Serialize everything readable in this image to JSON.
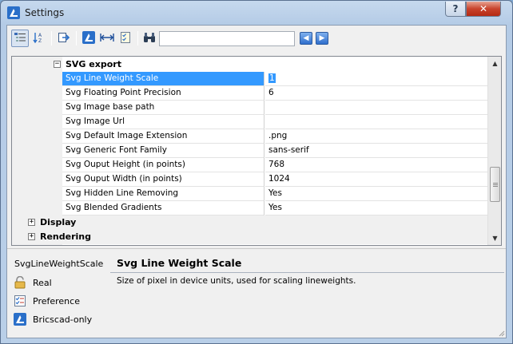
{
  "window": {
    "title": "Settings",
    "help_label": "?",
    "close_label": "✕"
  },
  "toolbar": {
    "buttons": [
      {
        "name": "categorized-view",
        "icon": "categorized-list-icon",
        "active": true
      },
      {
        "name": "alphabetical-view",
        "icon": "sort-az-icon",
        "active": false
      },
      {
        "name": "export",
        "icon": "export-icon",
        "active": false
      },
      {
        "name": "bricscad-filter",
        "icon": "bricscad-logo-icon",
        "active": false
      },
      {
        "name": "dimension-filter",
        "icon": "dimension-arrows-icon",
        "active": false
      },
      {
        "name": "checklist-filter",
        "icon": "checklist-icon",
        "active": false
      },
      {
        "name": "find",
        "icon": "binoculars-icon",
        "active": false
      }
    ],
    "search": {
      "value": "",
      "placeholder": ""
    },
    "prev_label": "◀",
    "next_label": "▶"
  },
  "grid": {
    "category": {
      "label": "SVG export",
      "expander": "−"
    },
    "properties": [
      {
        "name": "Svg Line Weight Scale",
        "value": "1",
        "selected": true
      },
      {
        "name": "Svg Floating Point Precision",
        "value": "6",
        "selected": false
      },
      {
        "name": "Svg Image base path",
        "value": "",
        "selected": false
      },
      {
        "name": "Svg Image Url",
        "value": "",
        "selected": false
      },
      {
        "name": "Svg Default Image Extension",
        "value": ".png",
        "selected": false
      },
      {
        "name": "Svg Generic Font Family",
        "value": "sans-serif",
        "selected": false
      },
      {
        "name": "Svg Ouput Height (in points)",
        "value": "768",
        "selected": false
      },
      {
        "name": "Svg Ouput Width (in points)",
        "value": "1024",
        "selected": false
      },
      {
        "name": "Svg Hidden Line Removing",
        "value": "Yes",
        "selected": false
      },
      {
        "name": "Svg Blended Gradients",
        "value": "Yes",
        "selected": false
      }
    ],
    "other_categories": [
      {
        "label": "Display",
        "expander": "+"
      },
      {
        "label": "Rendering",
        "expander": "+"
      }
    ]
  },
  "info": {
    "variable_name": "SvgLineWeightScale",
    "title": "Svg Line Weight Scale",
    "description": "Size of pixel in device units, used for scaling lineweights.",
    "attributes": [
      {
        "label": "Real",
        "icon": "lock-icon"
      },
      {
        "label": "Preference",
        "icon": "preference-checklist-icon"
      },
      {
        "label": "Bricscad-only",
        "icon": "bricscad-logo-icon"
      }
    ]
  },
  "colors": {
    "selection": "#3399ff",
    "title_bar": "#b9cfe8",
    "close_button": "#c8432c"
  }
}
